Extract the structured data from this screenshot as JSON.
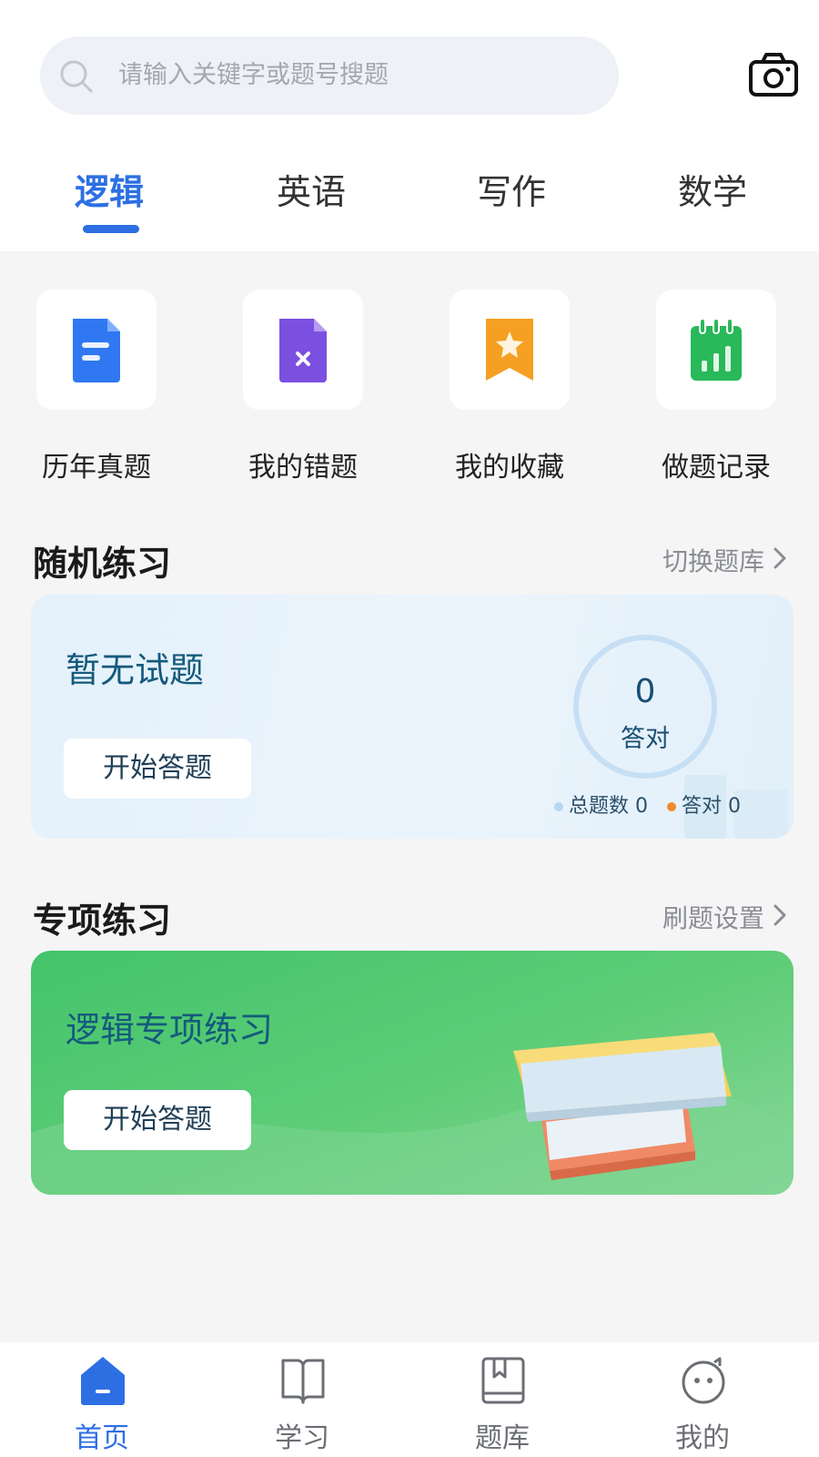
{
  "search": {
    "placeholder": "请输入关键字或题号搜题"
  },
  "tabs": [
    {
      "label": "逻辑",
      "active": true
    },
    {
      "label": "英语",
      "active": false
    },
    {
      "label": "写作",
      "active": false
    },
    {
      "label": "数学",
      "active": false
    }
  ],
  "quick_access": [
    {
      "label": "历年真题",
      "icon": "document-icon",
      "color": "#2f78f2"
    },
    {
      "label": "我的错题",
      "icon": "wrong-file-icon",
      "color": "#7b4fe0"
    },
    {
      "label": "我的收藏",
      "icon": "bookmark-star-icon",
      "color": "#f5a022"
    },
    {
      "label": "做题记录",
      "icon": "calendar-chart-icon",
      "color": "#29b85a"
    }
  ],
  "random_practice": {
    "title": "随机练习",
    "link": "切换题库",
    "card_title": "暂无试题",
    "button": "开始答题",
    "correct_count": "0",
    "correct_label": "答对",
    "stats_total_label": "总题数",
    "stats_total_value": "0",
    "stats_correct_label": "答对",
    "stats_correct_value": "0",
    "total_dot_color": "#b9d6f0",
    "correct_dot_color": "#f08a2c"
  },
  "special_practice": {
    "title": "专项练习",
    "link": "刷题设置",
    "card_title": "逻辑专项练习",
    "button": "开始答题"
  },
  "bottom_nav": [
    {
      "label": "首页",
      "icon": "home-icon",
      "active": true
    },
    {
      "label": "学习",
      "icon": "book-open-icon",
      "active": false
    },
    {
      "label": "题库",
      "icon": "question-bank-icon",
      "active": false
    },
    {
      "label": "我的",
      "icon": "profile-face-icon",
      "active": false
    }
  ],
  "colors": {
    "accent": "#2d6fe3",
    "page_bg": "#f5f5f6",
    "special_card": "#4fc870"
  }
}
